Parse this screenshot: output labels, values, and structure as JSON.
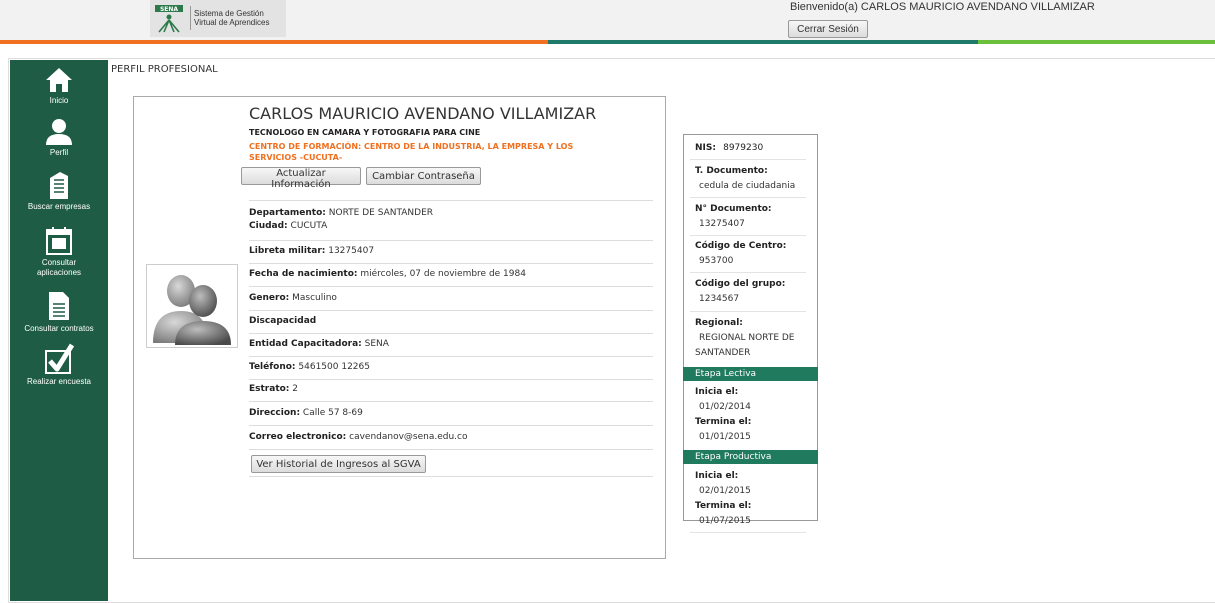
{
  "header": {
    "logo_brand": "SENA",
    "logo_line1": "Sistema de Gestión",
    "logo_line2": "Virtual de Aprendices",
    "welcome": "Bienvenido(a) CARLOS MAURICIO AVENDANO VILLAMIZAR",
    "logout_label": "Cerrar Sesión"
  },
  "colors": {
    "sidebar": "#1f5c46",
    "accent_orange": "#f07020",
    "band": "#1f7a5e",
    "stripe_green": "#6bbf3a"
  },
  "sidebar": {
    "items": [
      {
        "label": "Inicio",
        "icon": "home-icon"
      },
      {
        "label": "Perfil",
        "icon": "user-icon"
      },
      {
        "label": "Buscar empresas",
        "icon": "building-icon"
      },
      {
        "label": "Consultar aplicaciones",
        "icon": "calendar-icon"
      },
      {
        "label": "Consultar contratos",
        "icon": "document-icon"
      },
      {
        "label": "Realizar encuesta",
        "icon": "checkmark-icon"
      }
    ]
  },
  "breadcrumb": "PERFIL PROFESIONAL",
  "profile": {
    "name": "CARLOS MAURICIO AVENDANO VILLAMIZAR",
    "title": "TECNOLOGO EN CAMARA Y FOTOGRAFIA PARA CINE",
    "center": "CENTRO DE FORMACIÓN: CENTRO DE LA INDUSTRIA, LA EMPRESA Y LOS SERVICIOS -CUCUTA-",
    "update_label": "Actualizar Información",
    "password_label": "Cambiar Contraseña",
    "history_label": "Ver Historial de Ingresos al SGVA",
    "fields": {
      "departamento_label": "Departamento:",
      "departamento": "NORTE DE SANTANDER",
      "ciudad_label": "Ciudad:",
      "ciudad": "CUCUTA",
      "libreta_label": "Libreta militar:",
      "libreta": "13275407",
      "nacimiento_label": "Fecha de nacimiento:",
      "nacimiento": "miércoles, 07 de noviembre de 1984",
      "genero_label": "Genero:",
      "genero": "Masculino",
      "discapacidad_label": "Discapacidad",
      "entidad_label": "Entidad Capacitadora:",
      "entidad": "SENA",
      "telefono_label": "Teléfono:",
      "telefono": "5461500 12265",
      "estrato_label": "Estrato:",
      "estrato": "2",
      "direccion_label": "Direccion:",
      "direccion": "Calle 57 8-69",
      "correo_label": "Correo electronico:",
      "correo": "cavendanov@sena.edu.co"
    }
  },
  "info": {
    "nis_label": "NIS:",
    "nis": "8979230",
    "tdoc_label": "T. Documento:",
    "tdoc": "cedula de ciudadania",
    "ndoc_label": "N° Documento:",
    "ndoc": "13275407",
    "centro_label": "Código de Centro:",
    "centro": "953700",
    "grupo_label": "Código del grupo:",
    "grupo": "1234567",
    "regional_label": "Regional:",
    "regional_1": "REGIONAL NORTE DE",
    "regional_2": "SANTANDER",
    "lectiva": "Etapa Lectiva",
    "lectiva_inicia_label": "Inicia el:",
    "lectiva_inicia": "01/02/2014",
    "lectiva_termina_label": "Termina el:",
    "lectiva_termina": "01/01/2015",
    "productiva": "Etapa Productiva",
    "productiva_inicia_label": "Inicia el:",
    "productiva_inicia": "02/01/2015",
    "productiva_termina_label": "Termina el:",
    "productiva_termina": "01/07/2015"
  }
}
